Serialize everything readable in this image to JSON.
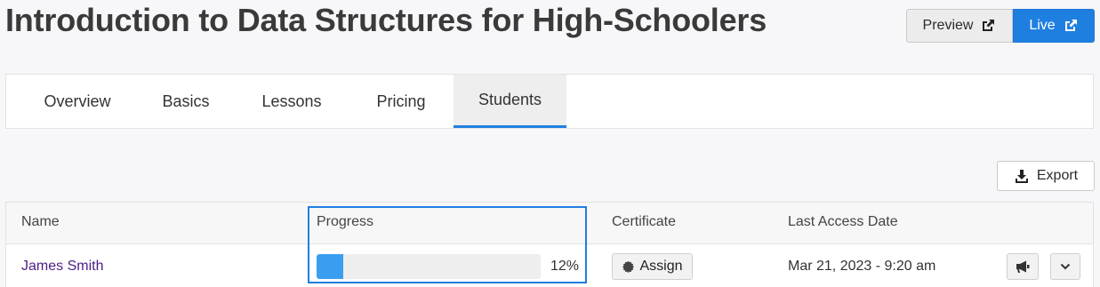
{
  "page": {
    "title": "Introduction to Data Structures for High-Schoolers"
  },
  "header_buttons": {
    "preview_label": "Preview",
    "live_label": "Live"
  },
  "tabs": [
    {
      "label": "Overview",
      "active": false
    },
    {
      "label": "Basics",
      "active": false
    },
    {
      "label": "Lessons",
      "active": false
    },
    {
      "label": "Pricing",
      "active": false
    },
    {
      "label": "Students",
      "active": true
    }
  ],
  "toolbar": {
    "export_label": "Export"
  },
  "table": {
    "columns": [
      "Name",
      "Progress",
      "Certificate",
      "Last Access Date"
    ],
    "rows": [
      {
        "name": "James Smith",
        "progress_percent": 12,
        "progress_label": "12%",
        "certificate_action": "Assign",
        "last_access": "Mar 21, 2023 - 9:20 am"
      }
    ]
  },
  "colors": {
    "accent": "#1f7fe0",
    "progress_fill": "#3a9ef0",
    "link": "#4b1e87"
  }
}
